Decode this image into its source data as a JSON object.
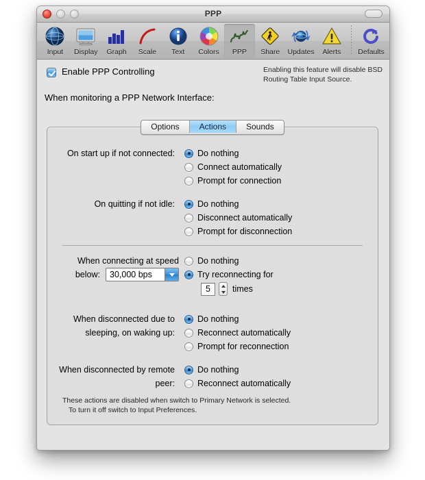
{
  "window": {
    "title": "PPP",
    "controls": {
      "close": "close-button",
      "minimize": "minimize-button",
      "zoom": "zoom-button",
      "toolbar_toggle": "toolbar-toggle-button"
    }
  },
  "toolbar": {
    "items": [
      {
        "label": "Input",
        "icon": "globe-icon",
        "selected": false
      },
      {
        "label": "Display",
        "icon": "monitor-icon",
        "selected": false
      },
      {
        "label": "Graph",
        "icon": "bar-chart-icon",
        "selected": false
      },
      {
        "label": "Scale",
        "icon": "curve-icon",
        "selected": false
      },
      {
        "label": "Text",
        "icon": "info-icon",
        "selected": false
      },
      {
        "label": "Colors",
        "icon": "color-wheel-icon",
        "selected": false
      },
      {
        "label": "PPP",
        "icon": "squiggle-icon",
        "selected": true
      },
      {
        "label": "Share",
        "icon": "pedestrian-sign-icon",
        "selected": false
      },
      {
        "label": "Updates",
        "icon": "refresh-globe-icon",
        "selected": false
      },
      {
        "label": "Alerts",
        "icon": "warning-triangle-icon",
        "selected": false
      },
      {
        "label": "Defaults",
        "icon": "reset-arrow-icon",
        "selected": false
      }
    ]
  },
  "main": {
    "enable_checkbox": {
      "label": "Enable PPP Controlling",
      "checked": true
    },
    "note_line1": "Enabling this feature will disable BSD",
    "note_line2": "Routing Table Input Source.",
    "section_heading": "When monitoring a PPP Network Interface:",
    "tabs": [
      {
        "label": "Options",
        "active": false
      },
      {
        "label": "Actions",
        "active": true
      },
      {
        "label": "Sounds",
        "active": false
      }
    ],
    "groups": [
      {
        "label": "On start up if not connected:",
        "options": [
          {
            "label": "Do nothing",
            "selected": true
          },
          {
            "label": "Connect automatically",
            "selected": false
          },
          {
            "label": "Prompt for connection",
            "selected": false
          }
        ]
      },
      {
        "label": "On quitting if not idle:",
        "options": [
          {
            "label": "Do nothing",
            "selected": true
          },
          {
            "label": "Disconnect automatically",
            "selected": false
          },
          {
            "label": "Prompt for disconnection",
            "selected": false
          }
        ]
      },
      {
        "label_line1": "When connecting at speed",
        "label_line2": "below:",
        "speed_value": "30,000 bps",
        "options": [
          {
            "label": "Do nothing",
            "selected": false
          },
          {
            "label": "Try reconnecting for",
            "selected": true
          }
        ],
        "retry_count": "5",
        "times_label": "times"
      },
      {
        "label_line1": "When disconnected due to",
        "label_line2": "sleeping, on waking up:",
        "options": [
          {
            "label": "Do nothing",
            "selected": true
          },
          {
            "label": "Reconnect automatically",
            "selected": false
          },
          {
            "label": "Prompt for reconnection",
            "selected": false
          }
        ]
      },
      {
        "label_line1": "When disconnected by remote",
        "label_line2": "peer:",
        "options": [
          {
            "label": "Do nothing",
            "selected": true
          },
          {
            "label": "Reconnect automatically",
            "selected": false
          }
        ]
      }
    ],
    "footnote_line1": "These actions are disabled when switch to Primary Network is selected.",
    "footnote_line2": "To turn it off switch to Input Preferences."
  },
  "colors": {
    "accent_blue": "#3d93e0",
    "selected_tab": "#8fcdf8",
    "window_bg": "#e4e4e4",
    "close_red": "#f0554b"
  }
}
